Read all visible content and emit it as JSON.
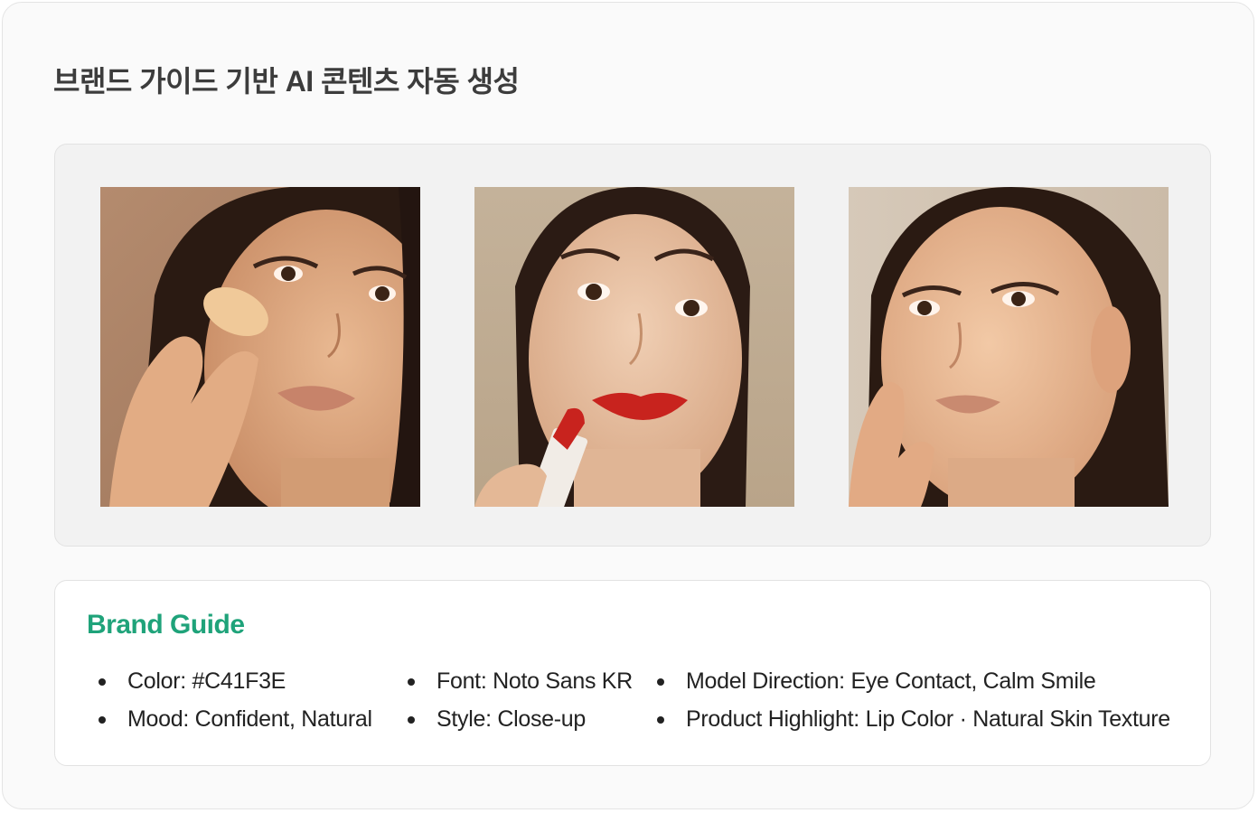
{
  "page": {
    "title": "브랜드 가이드 기반 AI 콘텐츠 자동 생성"
  },
  "gallery": {
    "images": [
      {
        "name": "model-foundation-swatch-photo",
        "subject": "model with foundation swatch on cheek"
      },
      {
        "name": "model-red-lipstick-photo",
        "subject": "model applying red lipstick"
      },
      {
        "name": "model-natural-skin-photo",
        "subject": "model with natural skin, hand on cheek"
      }
    ]
  },
  "brand_guide": {
    "title": "Brand Guide",
    "accent_color": "#1fa37a",
    "col1": [
      "Color: #C41F3E",
      "Mood: Confident, Natural"
    ],
    "col2": [
      "Font: Noto Sans KR",
      "Style: Close-up"
    ],
    "col3": [
      "Model Direction: Eye Contact, Calm Smile",
      "Product Highlight: Lip Color · Natural Skin Texture"
    ]
  }
}
